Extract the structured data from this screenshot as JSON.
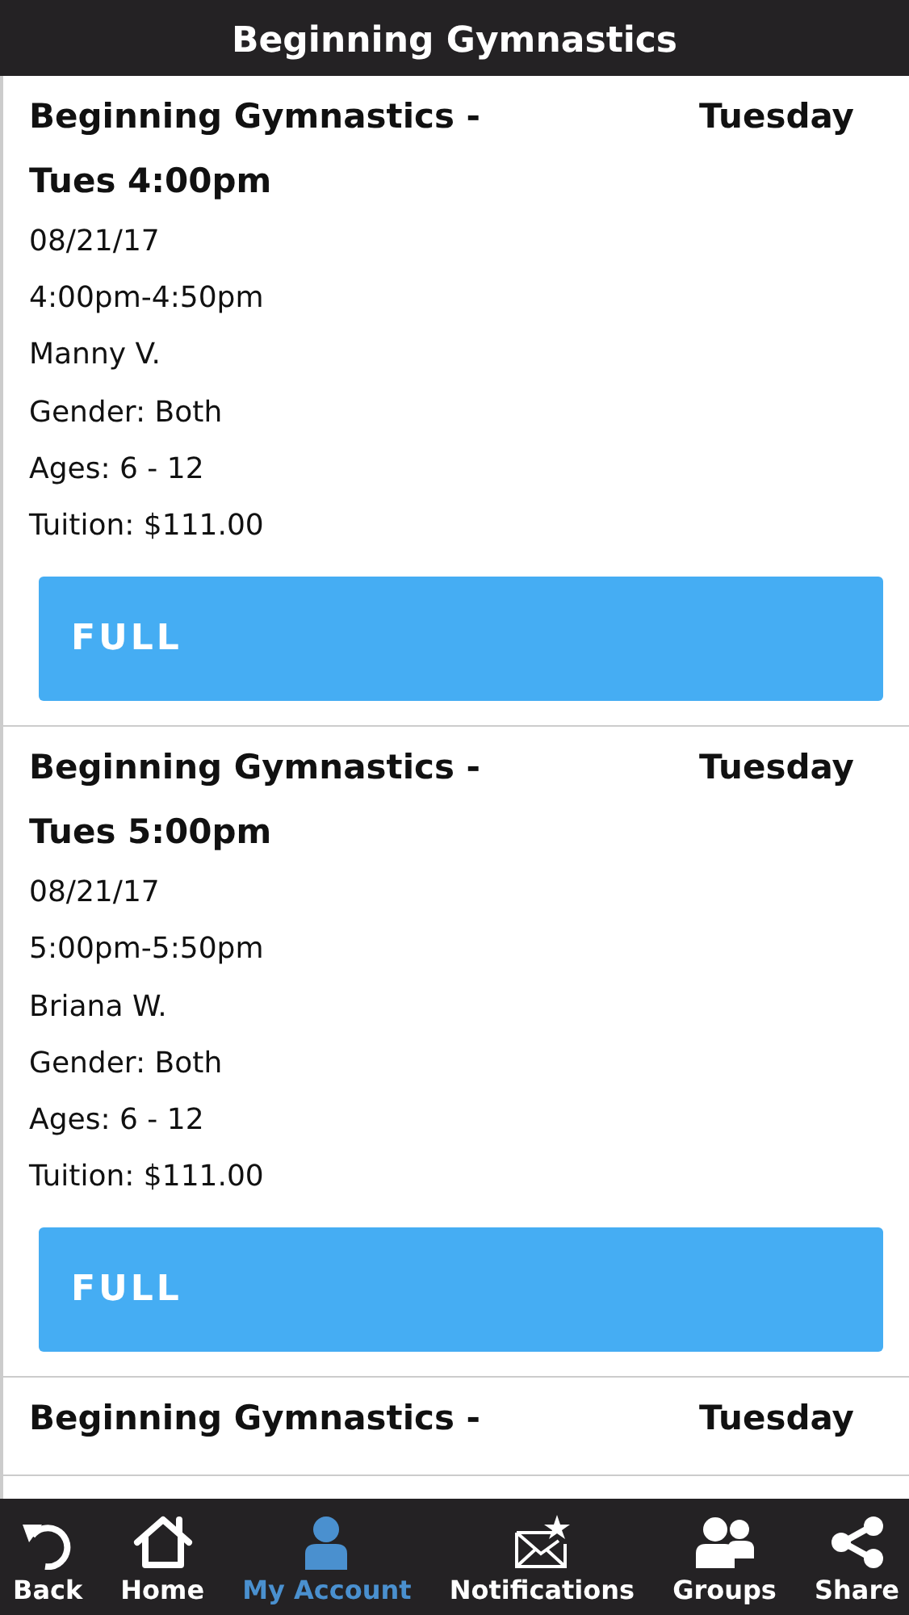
{
  "header": {
    "title": "Beginning Gymnastics"
  },
  "classes": [
    {
      "title_lines": [
        "Beginning Gymnastics -",
        "Tues 4:00pm"
      ],
      "day": "Tuesday",
      "details": [
        "08/21/17",
        "4:00pm-4:50pm",
        "Manny V.",
        "Gender: Both",
        "Ages: 6 - 12",
        "Tuition: $111.00"
      ],
      "button": "FULL"
    },
    {
      "title_lines": [
        "Beginning Gymnastics -",
        "Tues 5:00pm"
      ],
      "day": "Tuesday",
      "details": [
        "08/21/17",
        "5:00pm-5:50pm",
        "Briana W.",
        "Gender: Both",
        "Ages: 6 - 12",
        "Tuition: $111.00"
      ],
      "button": "FULL"
    },
    {
      "title_lines": [
        "Beginning Gymnastics -"
      ],
      "day": "Tuesday"
    }
  ],
  "nav": [
    {
      "kind": "back",
      "label": "Back",
      "selected": false
    },
    {
      "kind": "home",
      "label": "Home",
      "selected": false
    },
    {
      "kind": "account",
      "label": "My Account",
      "selected": true
    },
    {
      "kind": "notifications",
      "label": "Notifications",
      "selected": false
    },
    {
      "kind": "groups",
      "label": "Groups",
      "selected": false
    },
    {
      "kind": "share",
      "label": "Share",
      "selected": false
    }
  ]
}
